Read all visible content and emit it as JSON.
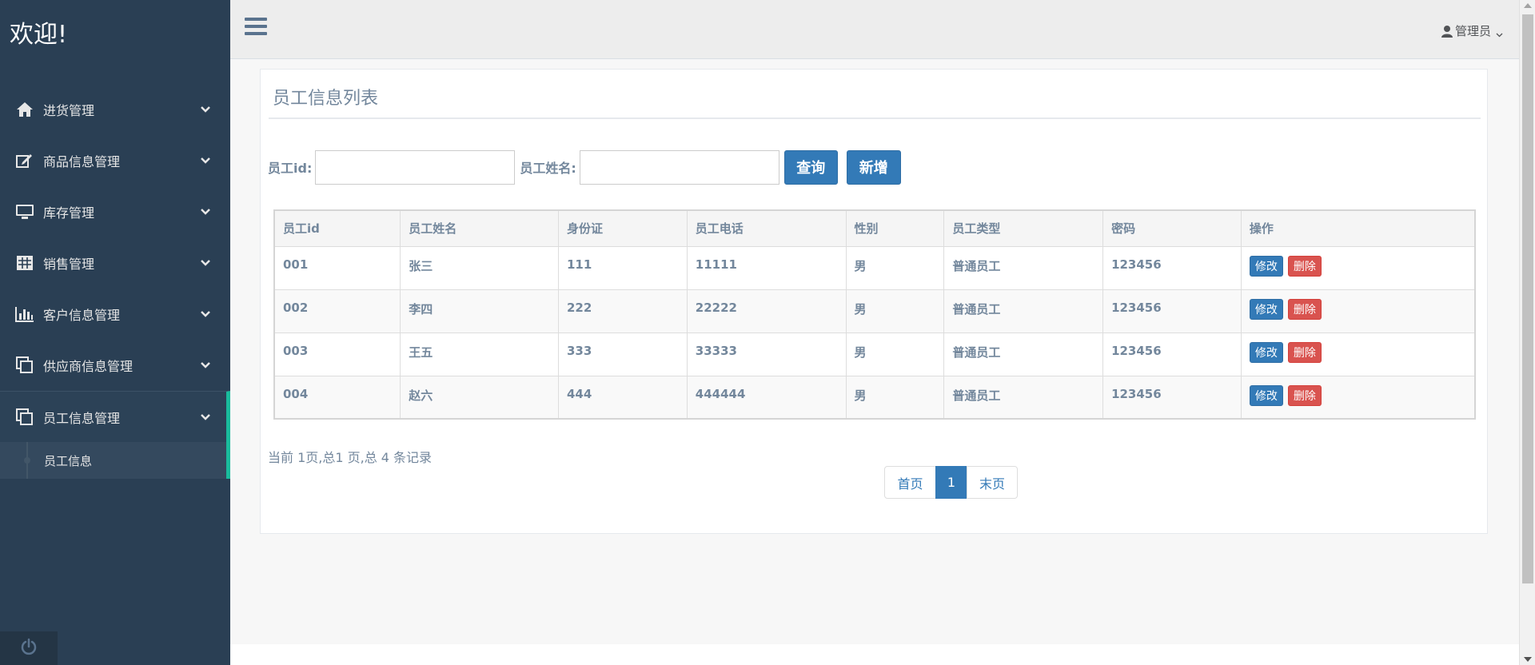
{
  "sidebar": {
    "brand": "欢迎!",
    "items": [
      {
        "label": "进货管理",
        "icon": "home-icon"
      },
      {
        "label": "商品信息管理",
        "icon": "edit-icon"
      },
      {
        "label": "库存管理",
        "icon": "monitor-icon"
      },
      {
        "label": "销售管理",
        "icon": "table-icon"
      },
      {
        "label": "客户信息管理",
        "icon": "bar-chart-icon"
      },
      {
        "label": "供应商信息管理",
        "icon": "copy-icon"
      },
      {
        "label": "员工信息管理",
        "icon": "copy-icon",
        "active": true
      }
    ],
    "submenu": [
      {
        "label": "员工信息"
      }
    ],
    "accent_color": "#1abb9c",
    "background_color": "#2a3f54"
  },
  "topnav": {
    "user_label": "管理员",
    "user_icon": "user-icon",
    "menu_icon": "hamburger-icon"
  },
  "panel": {
    "title": "员工信息列表",
    "search": {
      "id_label": "员工id:",
      "id_value": "",
      "name_label": "员工姓名:",
      "name_value": "",
      "query_button": "查询",
      "add_button": "新增"
    },
    "table": {
      "columns": [
        "员工id",
        "员工姓名",
        "身份证",
        "员工电话",
        "性别",
        "员工类型",
        "密码",
        "操作"
      ],
      "rows": [
        [
          "001",
          "张三",
          "111",
          "11111",
          "男",
          "普通员工",
          "123456"
        ],
        [
          "002",
          "李四",
          "222",
          "22222",
          "男",
          "普通员工",
          "123456"
        ],
        [
          "003",
          "王五",
          "333",
          "33333",
          "男",
          "普通员工",
          "123456"
        ],
        [
          "004",
          "赵六",
          "444",
          "444444",
          "男",
          "普通员工",
          "123456"
        ]
      ],
      "edit_label": "修改",
      "delete_label": "删除"
    },
    "page_info": "当前 1页,总1 页,总 4 条记录",
    "pagination": {
      "first": "首页",
      "current": "1",
      "last": "末页"
    }
  },
  "colors": {
    "primary": "#337ab7",
    "danger": "#d9534f",
    "text": "#73879c"
  }
}
